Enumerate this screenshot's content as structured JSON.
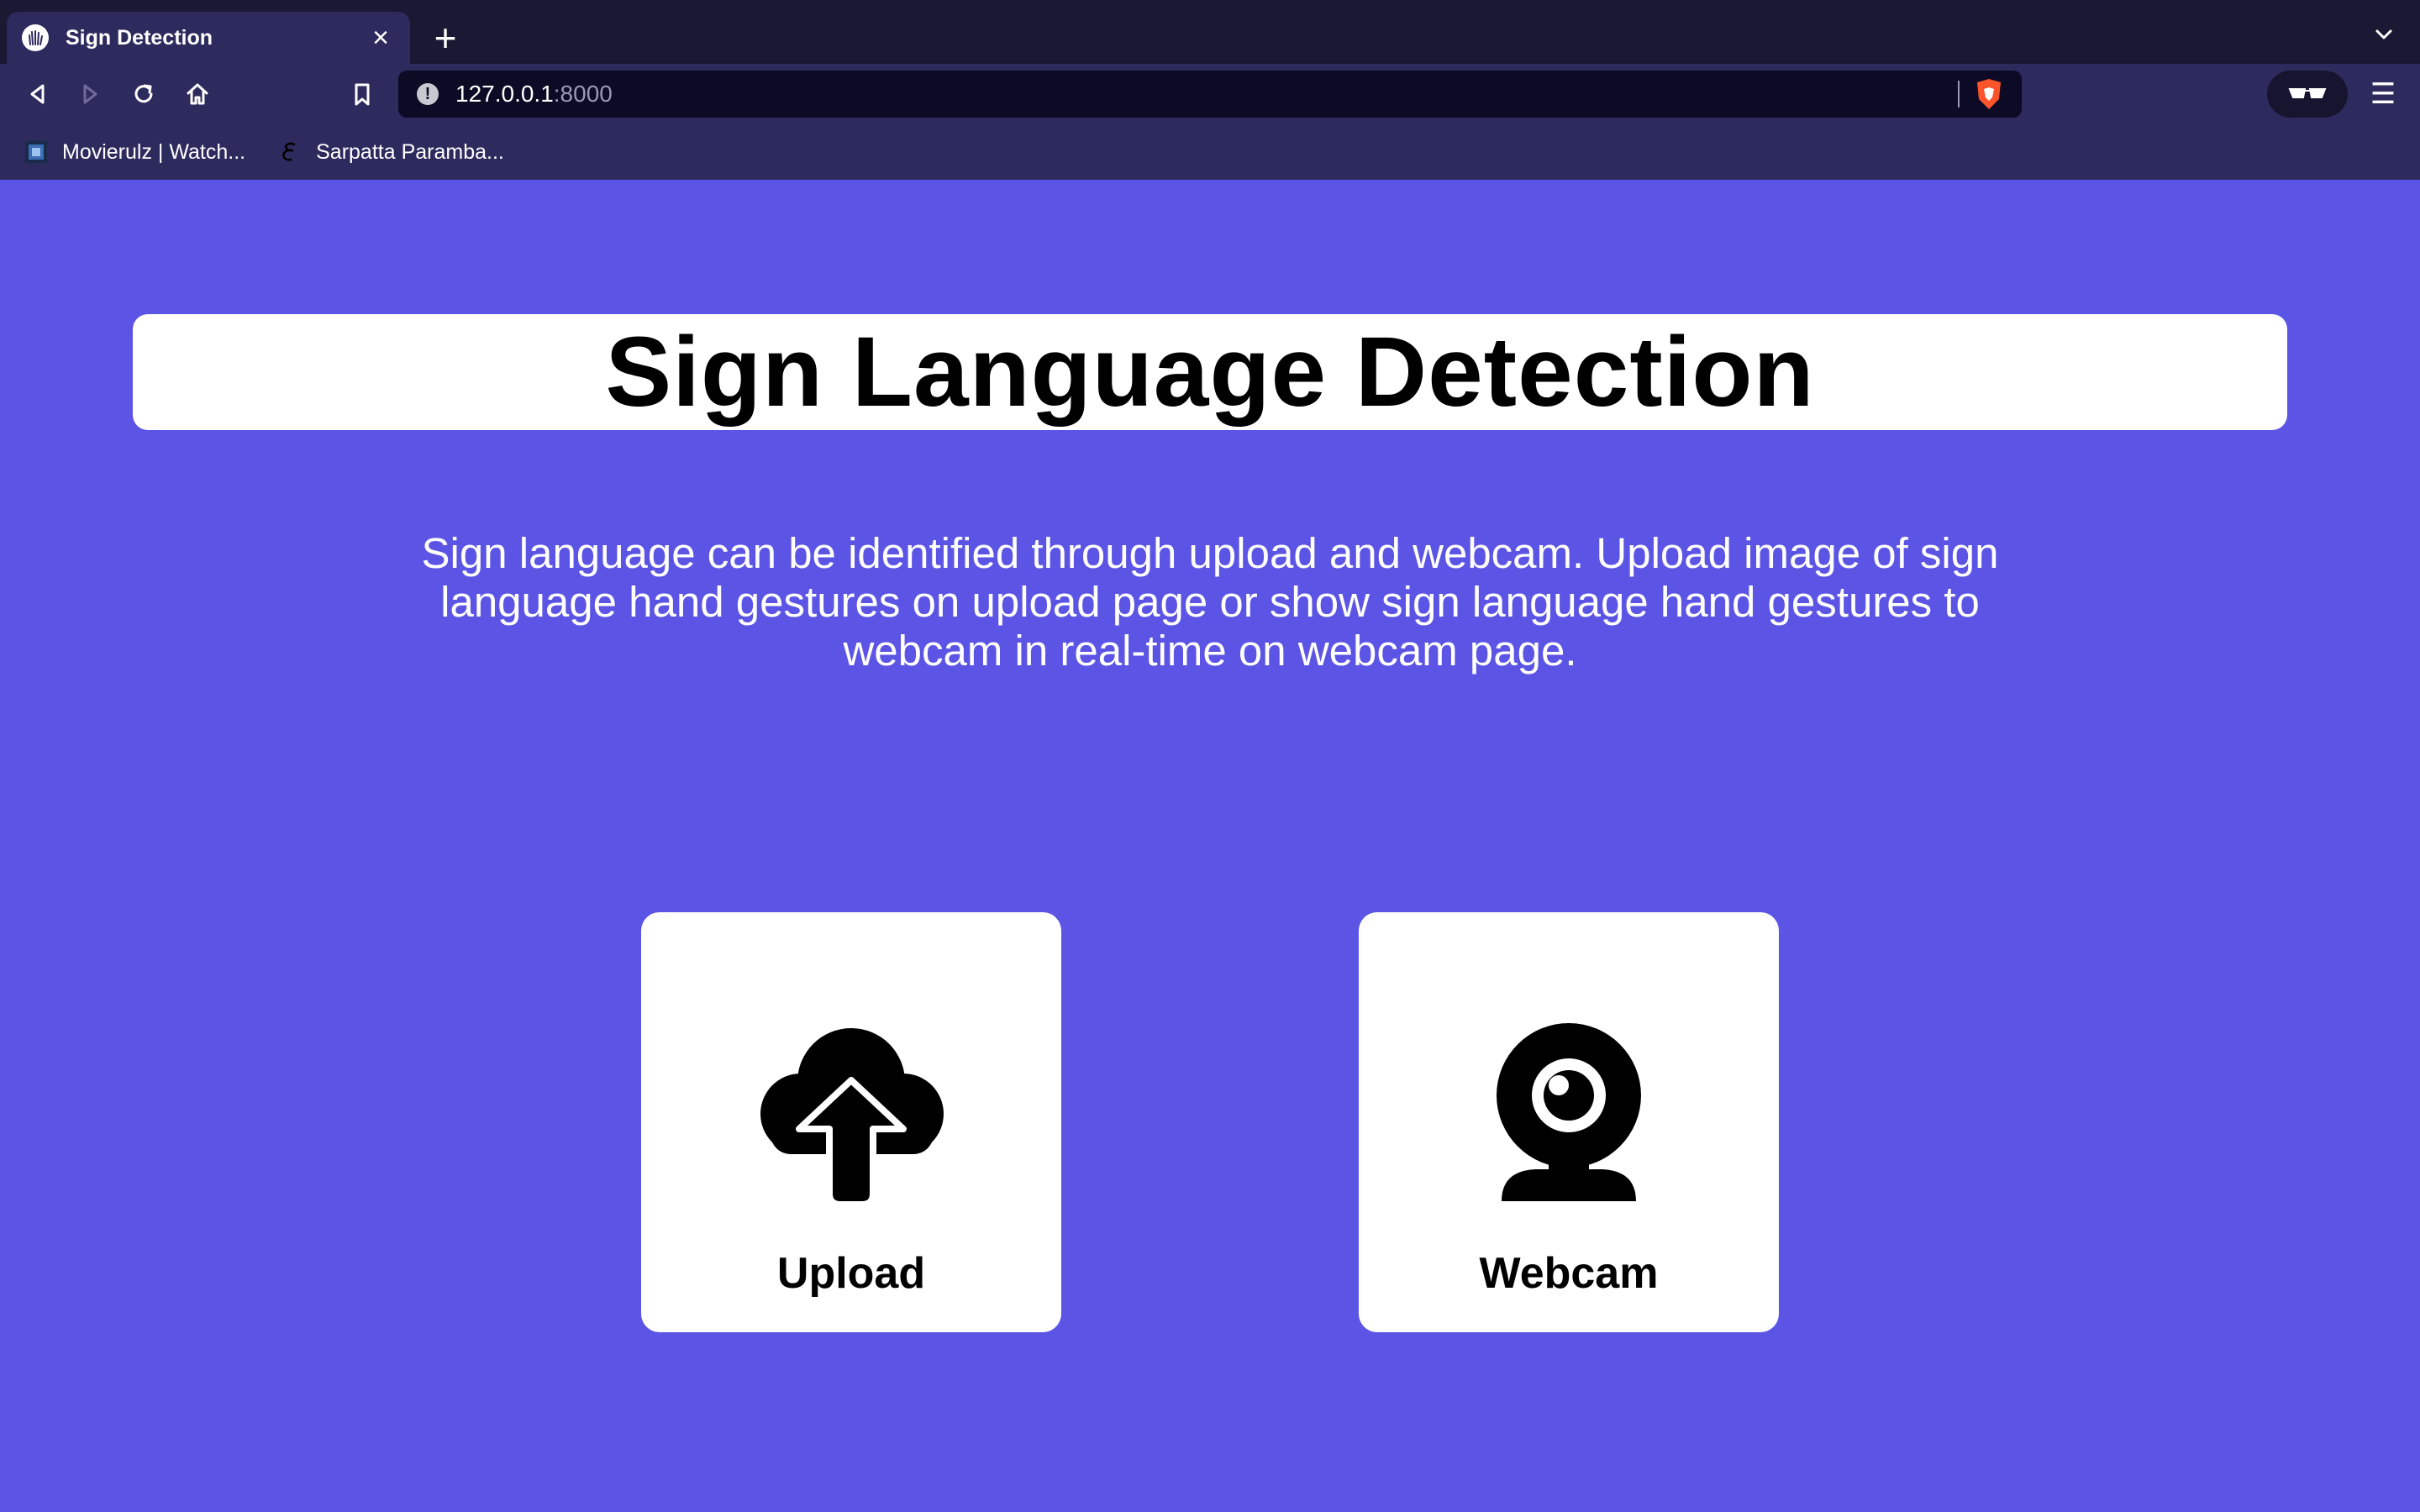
{
  "browser": {
    "tab": {
      "title": "Sign Detection",
      "favicon": "sign-hand-icon",
      "close_icon": "close-icon"
    },
    "new_tab_icon": "plus-icon",
    "tab_list_icon": "chevron-down-icon",
    "nav": {
      "back_icon": "back-icon",
      "forward_icon": "forward-icon",
      "reload_icon": "reload-icon",
      "home_icon": "home-icon",
      "bookmark_icon": "bookmark-icon"
    },
    "address_bar": {
      "host": "127.0.0.1",
      "port": ":8000",
      "info_icon": "info-icon",
      "shield_icon": "brave-shield-icon"
    },
    "vpn_icon": "glasses-icon",
    "menu_icon": "hamburger-menu-icon",
    "bookmarks": [
      {
        "label": "Movierulz | Watch...",
        "icon": "movierulz-icon"
      },
      {
        "label": "Sarpatta Paramba...",
        "icon": "script-e-icon"
      }
    ]
  },
  "page": {
    "title": "Sign Language Detection",
    "description": "Sign language can be identified through upload and webcam. Upload image of sign language hand gestures on upload page or show sign language hand gestures to webcam in real-time on webcam page.",
    "cards": [
      {
        "label": "Upload",
        "icon": "cloud-upload-icon"
      },
      {
        "label": "Webcam",
        "icon": "webcam-icon"
      }
    ]
  },
  "colors": {
    "background": "#5b54e4",
    "chrome_dark": "#1a1833",
    "chrome": "#2d2a5e",
    "url_bg": "#0c0a24",
    "card": "#ffffff",
    "text": "#000000",
    "brave_orange": "#fb542b"
  }
}
